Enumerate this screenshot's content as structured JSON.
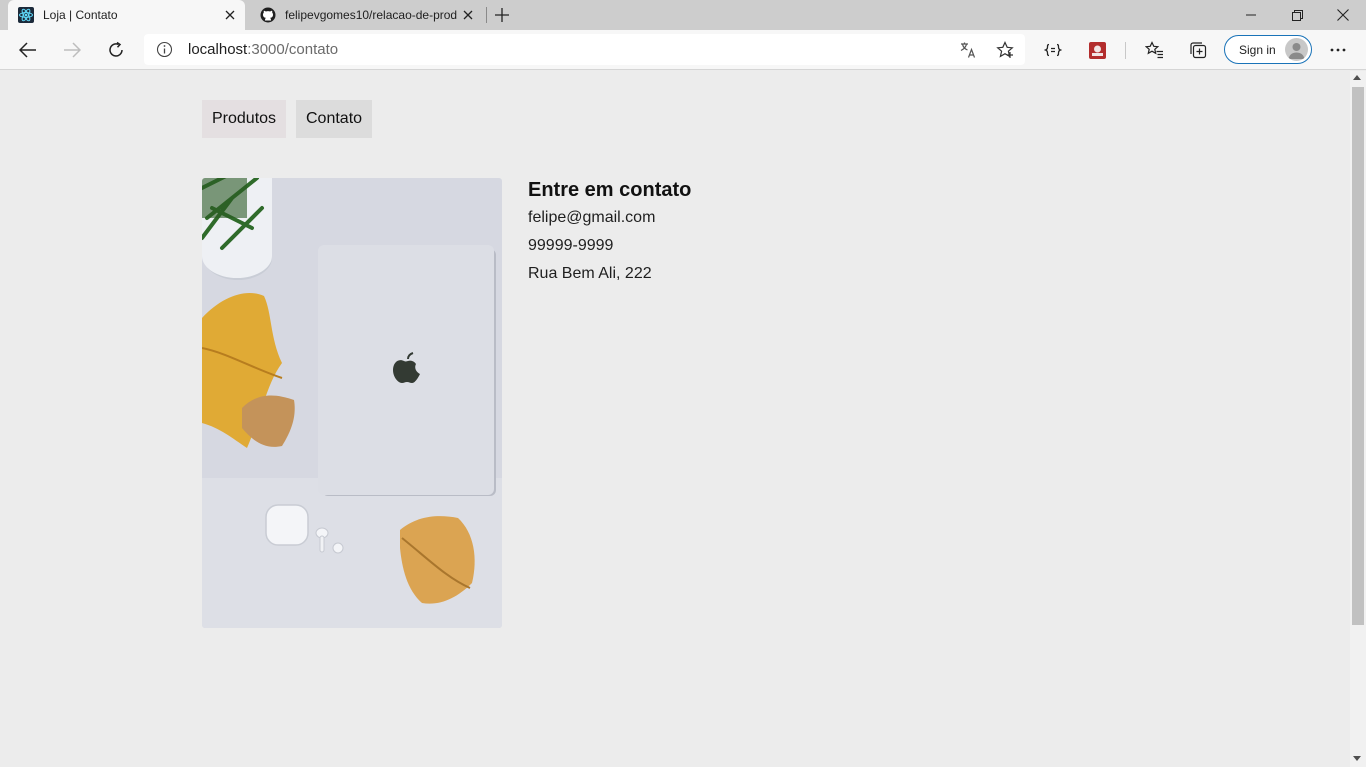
{
  "browser": {
    "tabs": [
      {
        "title": "Loja | Contato",
        "favicon": "react-icon",
        "active": true
      },
      {
        "title": "felipevgomes10/relacao-de-prod",
        "favicon": "github-icon",
        "active": false
      }
    ],
    "address": {
      "host": "localhost",
      "path": ":3000/contato"
    },
    "signin_label": "Sign in",
    "accent_color": "#1a73b8"
  },
  "nav": {
    "produtos": "Produtos",
    "contato": "Contato"
  },
  "contact": {
    "heading": "Entre em contato",
    "email": "felipe@gmail.com",
    "phone": "99999-9999",
    "address": "Rua Bem Ali, 222"
  }
}
